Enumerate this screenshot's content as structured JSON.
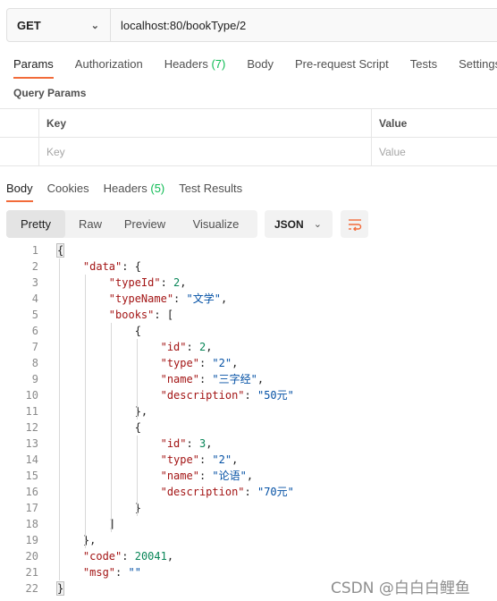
{
  "request": {
    "method": "GET",
    "url": "localhost:80/bookType/2"
  },
  "request_tabs": [
    {
      "label": "Params",
      "count": ""
    },
    {
      "label": "Authorization",
      "count": ""
    },
    {
      "label": "Headers",
      "count": "(7)"
    },
    {
      "label": "Body",
      "count": ""
    },
    {
      "label": "Pre-request Script",
      "count": ""
    },
    {
      "label": "Tests",
      "count": ""
    },
    {
      "label": "Settings",
      "count": ""
    }
  ],
  "query_params": {
    "title": "Query Params",
    "headers": [
      "Key",
      "Value"
    ],
    "placeholders": [
      "Key",
      "Value"
    ]
  },
  "response_tabs": [
    {
      "label": "Body",
      "count": ""
    },
    {
      "label": "Cookies",
      "count": ""
    },
    {
      "label": "Headers",
      "count": "(5)"
    },
    {
      "label": "Test Results",
      "count": ""
    }
  ],
  "view_modes": [
    "Pretty",
    "Raw",
    "Preview",
    "Visualize"
  ],
  "active_view": "Pretty",
  "format": "JSON",
  "icons": {
    "method_chevron": "chevron-down-icon",
    "format_chevron": "chevron-down-icon",
    "wrap": "wrap-lines-icon"
  },
  "colors": {
    "accent": "#f26b3a",
    "count": "#0cbb52",
    "json_key": "#a31515",
    "json_string": "#0451a5",
    "json_number": "#098658"
  },
  "code_lines": [
    {
      "no": "1",
      "tokens": [
        [
          "p",
          "{"
        ]
      ]
    },
    {
      "no": "2",
      "tokens": [
        [
          "p",
          "    "
        ],
        [
          "k",
          "\"data\""
        ],
        [
          "p",
          ": {"
        ]
      ]
    },
    {
      "no": "3",
      "tokens": [
        [
          "p",
          "        "
        ],
        [
          "k",
          "\"typeId\""
        ],
        [
          "p",
          ": "
        ],
        [
          "n",
          "2"
        ],
        [
          "p",
          ","
        ]
      ]
    },
    {
      "no": "4",
      "tokens": [
        [
          "p",
          "        "
        ],
        [
          "k",
          "\"typeName\""
        ],
        [
          "p",
          ": "
        ],
        [
          "s",
          "\"文学\""
        ],
        [
          "p",
          ","
        ]
      ]
    },
    {
      "no": "5",
      "tokens": [
        [
          "p",
          "        "
        ],
        [
          "k",
          "\"books\""
        ],
        [
          "p",
          ": ["
        ]
      ]
    },
    {
      "no": "6",
      "tokens": [
        [
          "p",
          "            {"
        ]
      ]
    },
    {
      "no": "7",
      "tokens": [
        [
          "p",
          "                "
        ],
        [
          "k",
          "\"id\""
        ],
        [
          "p",
          ": "
        ],
        [
          "n",
          "2"
        ],
        [
          "p",
          ","
        ]
      ]
    },
    {
      "no": "8",
      "tokens": [
        [
          "p",
          "                "
        ],
        [
          "k",
          "\"type\""
        ],
        [
          "p",
          ": "
        ],
        [
          "s",
          "\"2\""
        ],
        [
          "p",
          ","
        ]
      ]
    },
    {
      "no": "9",
      "tokens": [
        [
          "p",
          "                "
        ],
        [
          "k",
          "\"name\""
        ],
        [
          "p",
          ": "
        ],
        [
          "s",
          "\"三字经\""
        ],
        [
          "p",
          ","
        ]
      ]
    },
    {
      "no": "10",
      "tokens": [
        [
          "p",
          "                "
        ],
        [
          "k",
          "\"description\""
        ],
        [
          "p",
          ": "
        ],
        [
          "s",
          "\"50元\""
        ]
      ]
    },
    {
      "no": "11",
      "tokens": [
        [
          "p",
          "            },"
        ]
      ]
    },
    {
      "no": "12",
      "tokens": [
        [
          "p",
          "            {"
        ]
      ]
    },
    {
      "no": "13",
      "tokens": [
        [
          "p",
          "                "
        ],
        [
          "k",
          "\"id\""
        ],
        [
          "p",
          ": "
        ],
        [
          "n",
          "3"
        ],
        [
          "p",
          ","
        ]
      ]
    },
    {
      "no": "14",
      "tokens": [
        [
          "p",
          "                "
        ],
        [
          "k",
          "\"type\""
        ],
        [
          "p",
          ": "
        ],
        [
          "s",
          "\"2\""
        ],
        [
          "p",
          ","
        ]
      ]
    },
    {
      "no": "15",
      "tokens": [
        [
          "p",
          "                "
        ],
        [
          "k",
          "\"name\""
        ],
        [
          "p",
          ": "
        ],
        [
          "s",
          "\"论语\""
        ],
        [
          "p",
          ","
        ]
      ]
    },
    {
      "no": "16",
      "tokens": [
        [
          "p",
          "                "
        ],
        [
          "k",
          "\"description\""
        ],
        [
          "p",
          ": "
        ],
        [
          "s",
          "\"70元\""
        ]
      ]
    },
    {
      "no": "17",
      "tokens": [
        [
          "p",
          "            }"
        ]
      ]
    },
    {
      "no": "18",
      "tokens": [
        [
          "p",
          "        ]"
        ]
      ]
    },
    {
      "no": "19",
      "tokens": [
        [
          "p",
          "    },"
        ]
      ]
    },
    {
      "no": "20",
      "tokens": [
        [
          "p",
          "    "
        ],
        [
          "k",
          "\"code\""
        ],
        [
          "p",
          ": "
        ],
        [
          "n",
          "20041"
        ],
        [
          "p",
          ","
        ]
      ]
    },
    {
      "no": "21",
      "tokens": [
        [
          "p",
          "    "
        ],
        [
          "k",
          "\"msg\""
        ],
        [
          "p",
          ": "
        ],
        [
          "s",
          "\"\""
        ]
      ]
    },
    {
      "no": "22",
      "tokens": [
        [
          "p",
          "}"
        ]
      ]
    }
  ],
  "watermark": "CSDN @白白白鲤鱼"
}
